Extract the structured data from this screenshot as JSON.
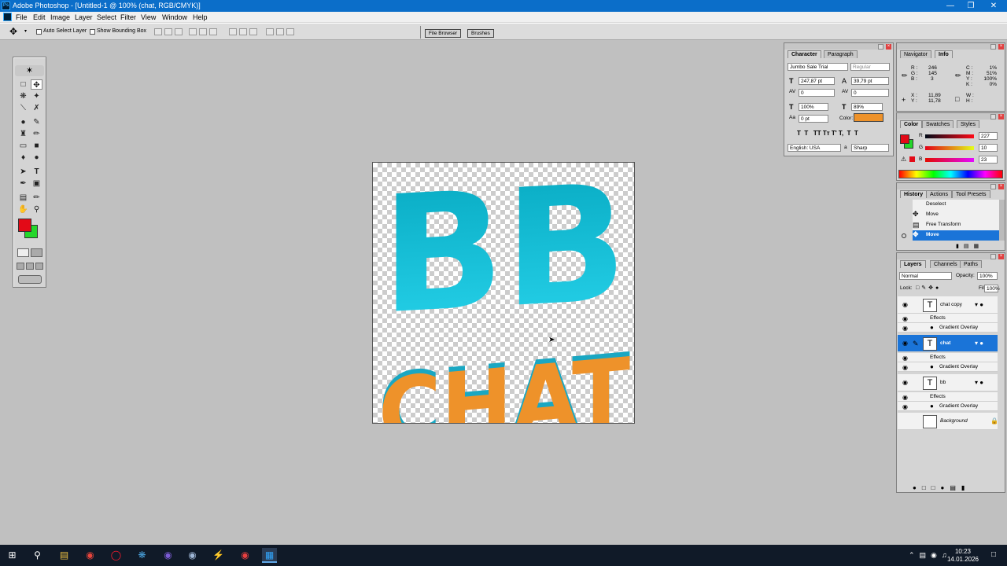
{
  "window": {
    "title": "Adobe Photoshop - [Untitled-1 @ 100% (chat, RGB/CMYK)]"
  },
  "menu": [
    "File",
    "Edit",
    "Image",
    "Layer",
    "Select",
    "Filter",
    "View",
    "Window",
    "Help"
  ],
  "options": {
    "auto_select": "Auto Select Layer",
    "show_bbox": "Show Bounding Box",
    "tabs": [
      "File Browser",
      "Brushes"
    ]
  },
  "canvas": {
    "top_text": "BB",
    "bottom_text": "CHAT",
    "top_color": "#1bc6de",
    "bottom_color": "#ee922a"
  },
  "character_panel": {
    "tabs": [
      "Character",
      "Paragraph"
    ],
    "font": "Jumbo Sale Trial",
    "style": "Regular",
    "size": "247,87 pt",
    "leading": "39,79 pt",
    "kerning": "0",
    "tracking": "0",
    "vscale": "100%",
    "hscale": "89%",
    "baseline": "0 pt",
    "color_label": "Color:",
    "color": "#ee922a",
    "glyphs": "T  T   TT Tт T' T,  T  T",
    "language": "English: USA",
    "aa_label": "a",
    "antialias": "Sharp"
  },
  "info_panel": {
    "tabs": [
      "Navigator",
      "Info"
    ],
    "r": "246",
    "g": "145",
    "b": "3",
    "c": "1%",
    "m": "51%",
    "y": "100%",
    "k": "0%",
    "x": "11,89",
    "yval": "11,78",
    "w": "",
    "h": ""
  },
  "color_panel": {
    "tabs": [
      "Color",
      "Swatches",
      "Styles"
    ],
    "r": "227",
    "g": "10",
    "b": "23"
  },
  "history_panel": {
    "tabs": [
      "History",
      "Actions",
      "Tool Presets"
    ],
    "items": [
      "Deselect",
      "Move",
      "Free Transform",
      "Move"
    ]
  },
  "layers_panel": {
    "tabs": [
      "Layers",
      "Channels",
      "Paths"
    ],
    "blend": "Normal",
    "opacity_label": "Opacity:",
    "opacity": "100%",
    "lock_label": "Lock:",
    "fill_label": "Fill:",
    "fill": "100%",
    "layers": [
      {
        "name": "chat copy",
        "effects": "Effects",
        "effect": "Gradient Overlay"
      },
      {
        "name": "chat",
        "effects": "Effects",
        "effect": "Gradient Overlay"
      },
      {
        "name": "bb",
        "effects": "Effects",
        "effect": "Gradient Overlay"
      },
      {
        "name": "Background"
      }
    ]
  },
  "taskbar": {
    "time": "10:23",
    "date": "14.01.2026"
  }
}
